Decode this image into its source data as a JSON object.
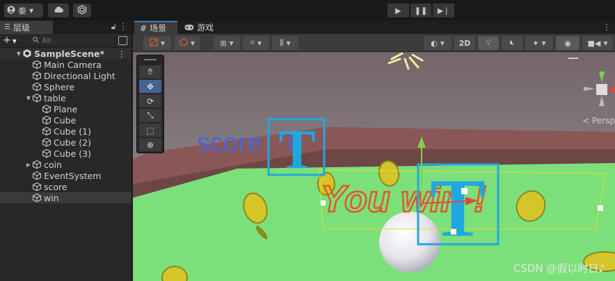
{
  "top_toolbar": {
    "account_label": "秦",
    "account_icon": "account-icon",
    "cloud_icon": "cloud-icon",
    "collab_icon": "collab-icon",
    "play_icon": "play-icon",
    "pause_icon": "pause-icon",
    "step_icon": "step-icon"
  },
  "hierarchy": {
    "tab_label": "层级",
    "search_placeholder": "All",
    "items": [
      {
        "label": "SampleScene*",
        "depth": 0,
        "type": "scene",
        "expanded": true
      },
      {
        "label": "Main Camera",
        "depth": 1
      },
      {
        "label": "Directional Light",
        "depth": 1
      },
      {
        "label": "Sphere",
        "depth": 1
      },
      {
        "label": "table",
        "depth": 1,
        "expanded": true
      },
      {
        "label": "Plane",
        "depth": 2
      },
      {
        "label": "Cube",
        "depth": 2
      },
      {
        "label": "Cube (1)",
        "depth": 2
      },
      {
        "label": "Cube (2)",
        "depth": 2
      },
      {
        "label": "Cube (3)",
        "depth": 2
      },
      {
        "label": "coin",
        "depth": 1,
        "expanded": false
      },
      {
        "label": "EventSystem",
        "depth": 1
      },
      {
        "label": "score",
        "depth": 1
      },
      {
        "label": "win",
        "depth": 1,
        "selected": true
      }
    ]
  },
  "scene_view": {
    "tab_scene": "场景",
    "tab_game": "游戏",
    "btn_2d": "2D",
    "persp_label": "< Persp",
    "score_text": "score：0",
    "win_text": "You win !",
    "text_icon_glyph": "T",
    "colors": {
      "sky_top": "#7c6b6f",
      "floor_green": "#7be07a",
      "coin_yellow": "#d4c52a",
      "score_blue": "#4a66d6",
      "win_red": "#e8542a",
      "gizmo_cyan": "#21a7e0"
    }
  },
  "watermark": "CSDN @假以时日♪"
}
